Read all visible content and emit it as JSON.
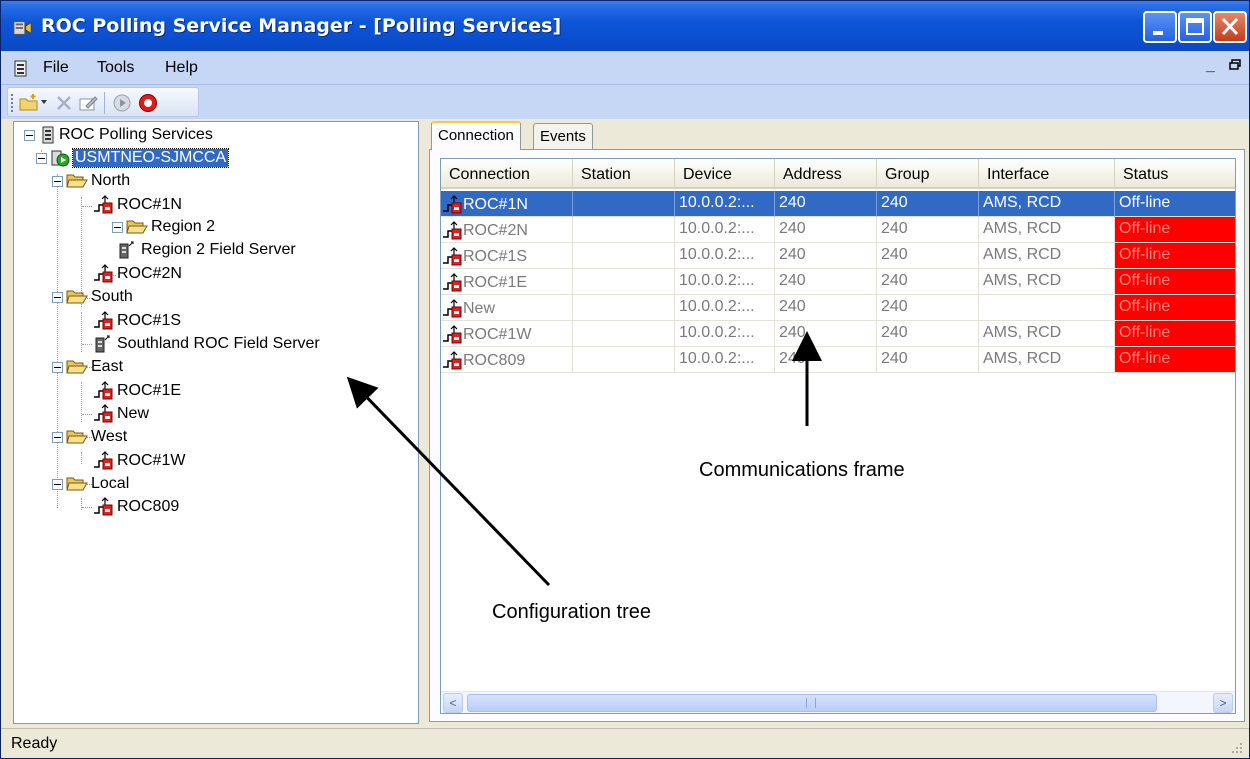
{
  "window": {
    "title": "ROC Polling Service Manager - [Polling Services]"
  },
  "menu": {
    "file": "File",
    "tools": "Tools",
    "help": "Help"
  },
  "toolbar": {
    "icons": [
      "new-folder-icon",
      "dropdown-arrow-icon",
      "delete-icon",
      "edit-properties-icon",
      "start-icon",
      "stop-icon"
    ]
  },
  "tree": {
    "root": "ROC Polling Services",
    "server": "USMTNEO-SJMCCA",
    "north": "North",
    "roc1n": "ROC#1N",
    "region2": "Region 2",
    "region2_fs": "Region 2 Field Server",
    "roc2n": "ROC#2N",
    "south": "South",
    "roc1s": "ROC#1S",
    "southland_fs": "Southland ROC Field Server",
    "east": "East",
    "roc1e": "ROC#1E",
    "new": "New",
    "west": "West",
    "roc1w": "ROC#1W",
    "local": "Local",
    "roc809": "ROC809"
  },
  "tabs": {
    "connection": "Connection",
    "events": "Events"
  },
  "grid": {
    "columns": [
      "Connection",
      "Station",
      "Device",
      "Address",
      "Group",
      "Interface",
      "Status"
    ],
    "rows": [
      {
        "connection": "ROC#1N",
        "station": "",
        "device": "10.0.0.2:...",
        "address": "240",
        "group": "240",
        "interface": "AMS, RCD",
        "status": "Off-line"
      },
      {
        "connection": "ROC#2N",
        "station": "",
        "device": "10.0.0.2:...",
        "address": "240",
        "group": "240",
        "interface": "AMS, RCD",
        "status": "Off-line"
      },
      {
        "connection": "ROC#1S",
        "station": "",
        "device": "10.0.0.2:...",
        "address": "240",
        "group": "240",
        "interface": "AMS, RCD",
        "status": "Off-line"
      },
      {
        "connection": "ROC#1E",
        "station": "",
        "device": "10.0.0.2:...",
        "address": "240",
        "group": "240",
        "interface": "AMS, RCD",
        "status": "Off-line"
      },
      {
        "connection": "New",
        "station": "",
        "device": "10.0.0.2:...",
        "address": "240",
        "group": "240",
        "interface": "",
        "status": "Off-line"
      },
      {
        "connection": "ROC#1W",
        "station": "",
        "device": "10.0.0.2:...",
        "address": "240",
        "group": "240",
        "interface": "AMS, RCD",
        "status": "Off-line"
      },
      {
        "connection": "ROC809",
        "station": "",
        "device": "10.0.0.2:...",
        "address": "240",
        "group": "240",
        "interface": "AMS, RCD",
        "status": "Off-line"
      }
    ],
    "selected_row": 0
  },
  "annotations": {
    "communications": "Communications frame",
    "configuration": "Configuration tree"
  },
  "status": {
    "text": "Ready"
  },
  "colors": {
    "title_bar": "#0a4fcf",
    "selection": "#316ac5",
    "offline": "#ff0000"
  }
}
